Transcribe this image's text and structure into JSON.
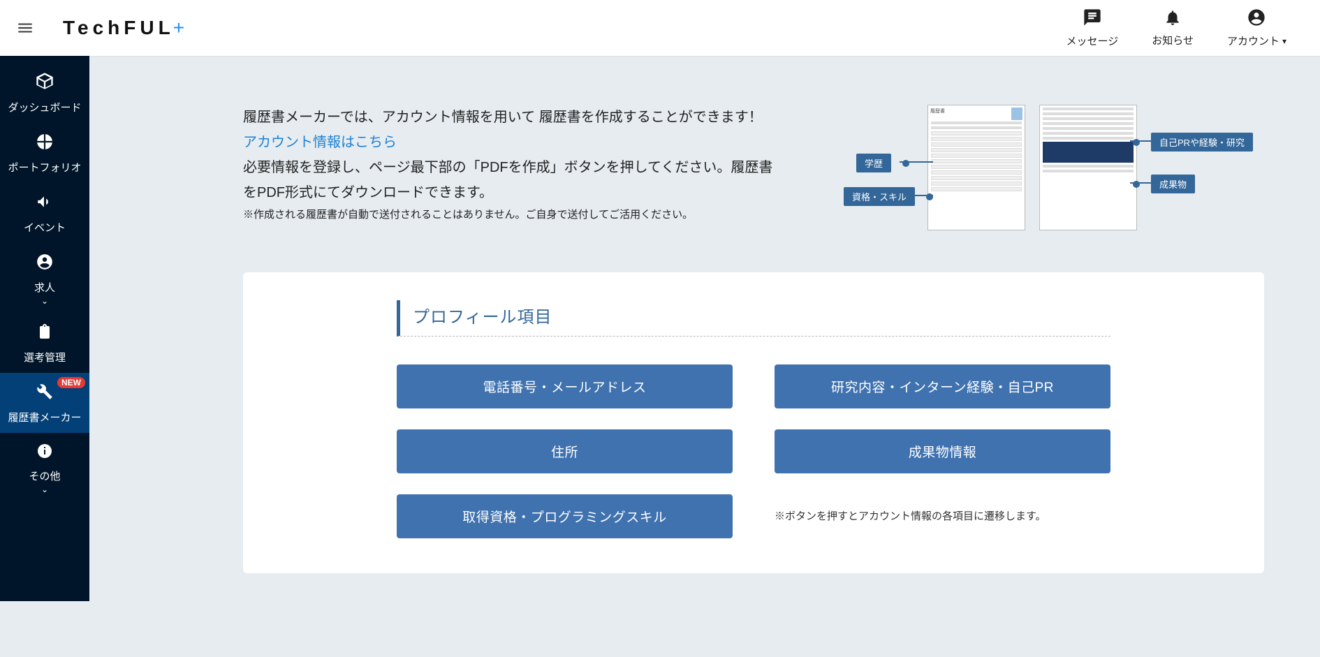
{
  "header": {
    "logo": {
      "text": "TechFUL",
      "suffix": "+"
    },
    "items": [
      {
        "id": "messages",
        "label": "メッセージ"
      },
      {
        "id": "notifications",
        "label": "お知らせ"
      },
      {
        "id": "account",
        "label": "アカウント"
      }
    ]
  },
  "sidebar": {
    "items": [
      {
        "id": "dashboard",
        "label": "ダッシュボード",
        "new": false
      },
      {
        "id": "portfolio",
        "label": "ポートフォリオ",
        "new": false
      },
      {
        "id": "event",
        "label": "イベント",
        "new": false
      },
      {
        "id": "jobs",
        "label": "求人",
        "new": false,
        "caret": true
      },
      {
        "id": "selection",
        "label": "選考管理",
        "new": false
      },
      {
        "id": "resume",
        "label": "履歴書メーカー",
        "new": true,
        "active": true
      },
      {
        "id": "other",
        "label": "その他",
        "new": false,
        "caret": true
      }
    ],
    "new_badge": "NEW"
  },
  "intro": {
    "line1": "履歴書メーカーでは、アカウント情報を用いて 履歴書を作成することができます！",
    "link": "アカウント情報はこちら",
    "line2": "必要情報を登録し、ページ最下部の「PDFを作成」ボタンを押してください。履歴書をPDF形式にてダウンロードできます。",
    "note": "※作成される履歴書が自動で送付されることはありません。ご自身で送付してご活用ください。"
  },
  "preview": {
    "doc_title": "履歴書",
    "tags": {
      "gakureki": "学歴",
      "shikaku": "資格・スキル",
      "pr": "自己PRや経験・研究",
      "seika": "成果物"
    }
  },
  "card": {
    "section_title": "プロフィール項目",
    "buttons": {
      "phone": "電話番号・メールアドレス",
      "research": "研究内容・インターン経験・自己PR",
      "address": "住所",
      "results": "成果物情報",
      "skills": "取得資格・プログラミングスキル"
    },
    "note": "※ボタンを押すとアカウント情報の各項目に遷移します。"
  }
}
